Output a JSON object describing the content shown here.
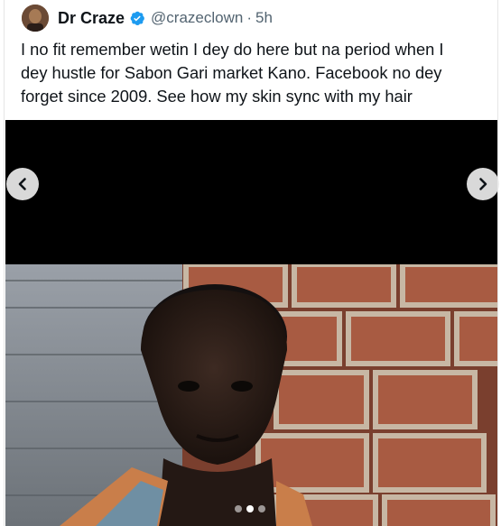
{
  "author": {
    "display_name": "Dr Craze",
    "handle": "@crazeclown",
    "separator": "·",
    "timestamp": "5h",
    "avatar_icon": "avatar-photo",
    "verified_icon": "verified-badge-icon",
    "verified_color": "#1d9bf0"
  },
  "tweet": {
    "text_lines": [
      "I no fit remember wetin I dey do here but na period when I",
      "dey hustle for Sabon Gari market Kano. Facebook no dey",
      "forget since 2009. See how my skin sync with my hair"
    ]
  },
  "media": {
    "prev_icon": "chevron-left-icon",
    "next_icon": "chevron-right-icon",
    "page_count": 3,
    "active_page": 2
  }
}
